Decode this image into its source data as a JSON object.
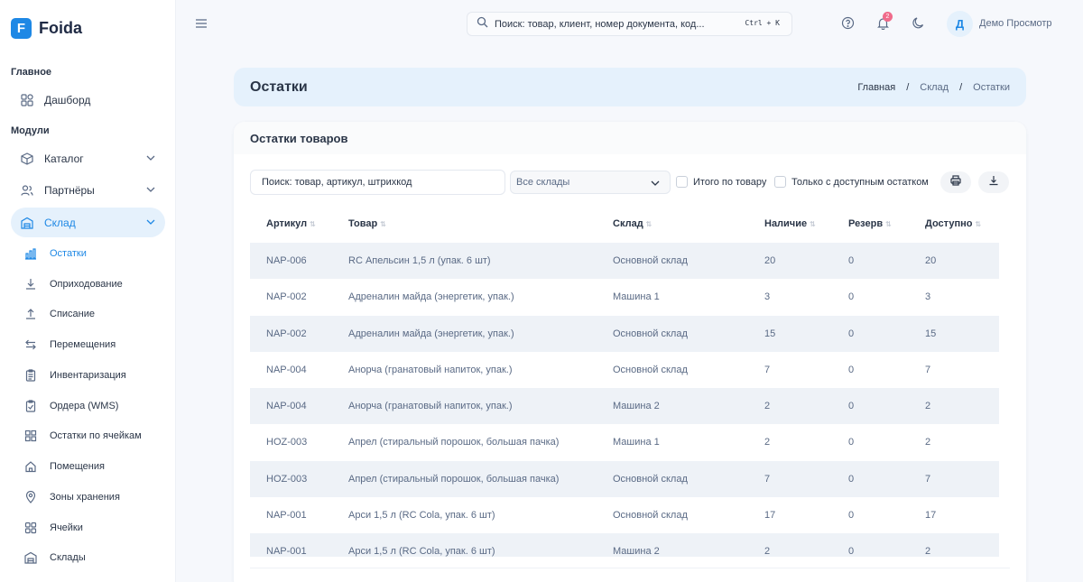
{
  "app": {
    "logo_letter": "F",
    "name": "Foida"
  },
  "sidebar": {
    "section_main": "Главное",
    "dashboard": "Дашборд",
    "section_modules": "Модули",
    "catalog": "Каталог",
    "partners": "Партнёры",
    "warehouse": "Склад",
    "sub_items": [
      {
        "label": "Остатки",
        "icon": "bar-chart-icon"
      },
      {
        "label": "Оприходование",
        "icon": "download-icon"
      },
      {
        "label": "Списание",
        "icon": "upload-icon"
      },
      {
        "label": "Перемещения",
        "icon": "transfer-icon"
      },
      {
        "label": "Инвентаризация",
        "icon": "clipboard-icon"
      },
      {
        "label": "Ордера (WMS)",
        "icon": "clipboard-check-icon"
      },
      {
        "label": "Остатки по ячейкам",
        "icon": "grid-icon"
      },
      {
        "label": "Помещения",
        "icon": "home-icon"
      },
      {
        "label": "Зоны хранения",
        "icon": "map-pin-icon"
      },
      {
        "label": "Ячейки",
        "icon": "cells-icon"
      },
      {
        "label": "Склады",
        "icon": "building-icon"
      }
    ]
  },
  "topbar": {
    "search_placeholder": "Поиск: товар, клиент, номер документа, код...",
    "shortcut": "Ctrl + K",
    "notifications_count": "2",
    "avatar_letter": "Д",
    "user_name": "Демо Просмотр"
  },
  "page": {
    "title": "Остатки",
    "breadcrumb": [
      "Главная",
      "Склад",
      "Остатки"
    ],
    "sep": "/"
  },
  "card": {
    "title": "Остатки товаров",
    "filter_search": "Поиск: товар, артикул, штрихкод",
    "warehouse_select": "Все склады",
    "check_total": "Итого по товару",
    "check_available": "Только с доступным остатком"
  },
  "table": {
    "columns": [
      "Артикул",
      "Товар",
      "Склад",
      "Наличие",
      "Резерв",
      "Доступно"
    ],
    "rows": [
      [
        "NAP-006",
        "RC Апельсин 1,5 л (упак. 6 шт)",
        "Основной склад",
        "20",
        "0",
        "20"
      ],
      [
        "NAP-002",
        "Адреналин майда (энергетик, упак.)",
        "Машина 1",
        "3",
        "0",
        "3"
      ],
      [
        "NAP-002",
        "Адреналин майда (энергетик, упак.)",
        "Основной склад",
        "15",
        "0",
        "15"
      ],
      [
        "NAP-004",
        "Анорча (гранатовый напиток, упак.)",
        "Основной склад",
        "7",
        "0",
        "7"
      ],
      [
        "NAP-004",
        "Анорча (гранатовый напиток, упак.)",
        "Машина 2",
        "2",
        "0",
        "2"
      ],
      [
        "HOZ-003",
        "Апрел (стиральный порошок, большая пачка)",
        "Машина 1",
        "2",
        "0",
        "2"
      ],
      [
        "HOZ-003",
        "Апрел (стиральный порошок, большая пачка)",
        "Основной склад",
        "7",
        "0",
        "7"
      ],
      [
        "NAP-001",
        "Арси 1,5 л (RC Cola, упак. 6 шт)",
        "Основной склад",
        "17",
        "0",
        "17"
      ],
      [
        "NAP-001",
        "Арси 1,5 л (RC Cola, упак. 6 шт)",
        "Машина 2",
        "2",
        "0",
        "2"
      ]
    ]
  },
  "colors": {
    "accent": "#1e88e5",
    "active_bg": "#e5f1fc",
    "row_shade": "#eef2f7",
    "badge": "#f06b8b"
  }
}
